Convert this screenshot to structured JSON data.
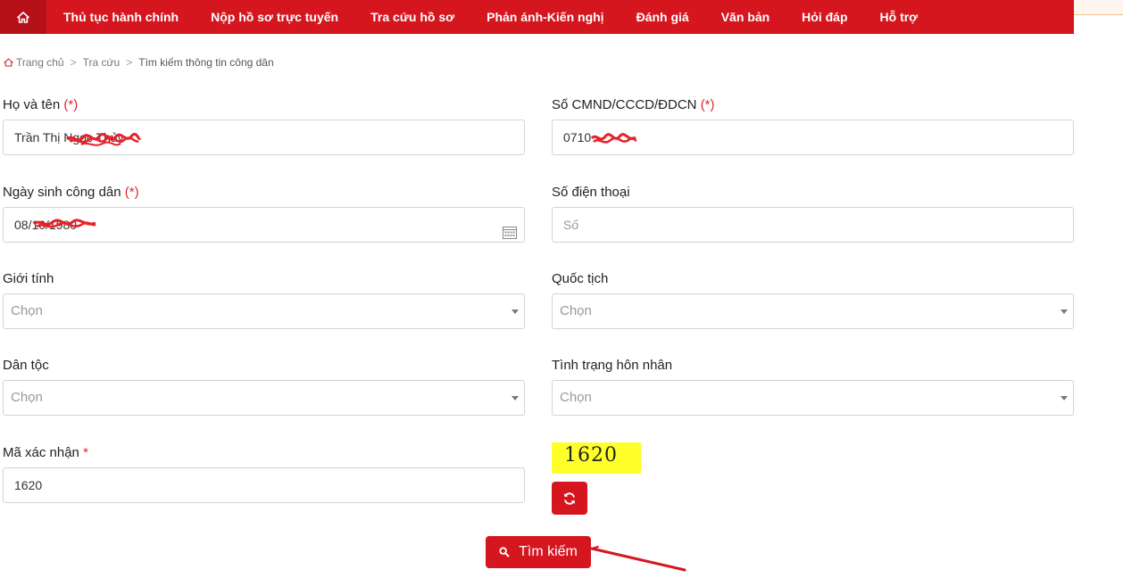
{
  "nav": {
    "items": [
      "Thủ tục hành chính",
      "Nộp hồ sơ trực tuyến",
      "Tra cứu hồ sơ",
      "Phản ánh-Kiến nghị",
      "Đánh giá",
      "Văn bản",
      "Hỏi đáp",
      "Hỗ trợ"
    ]
  },
  "breadcrumb": {
    "home": "Trang chủ",
    "lookup": "Tra cứu",
    "current": "Tìm kiếm thông tin công dân"
  },
  "form": {
    "required_mark": "(*)",
    "captcha_required_mark": "*",
    "fullname": {
      "label": "Họ và tên",
      "value": "Trần Thị Ngọc Thủy"
    },
    "id_number": {
      "label": "Số CMND/CCCD/ĐDCN",
      "value": "0710"
    },
    "birthdate": {
      "label": "Ngày sinh công dân",
      "value": "08/10/1980"
    },
    "phone": {
      "label": "Số điện thoại",
      "placeholder": "Số"
    },
    "gender": {
      "label": "Giới tính",
      "selected": "Chọn"
    },
    "nationality": {
      "label": "Quốc tịch",
      "selected": "Chọn"
    },
    "ethnicity": {
      "label": "Dân tộc",
      "selected": "Chọn"
    },
    "marital_status": {
      "label": "Tình trạng hôn nhân",
      "selected": "Chọn"
    },
    "captcha": {
      "label": "Mã xác nhận",
      "value": "1620",
      "image_text": "1620"
    }
  },
  "actions": {
    "search_label": "Tìm kiếm"
  },
  "colors": {
    "brand_red": "#d5161f",
    "captcha_bg": "#ffff2a",
    "scribble": "#e8202a"
  }
}
